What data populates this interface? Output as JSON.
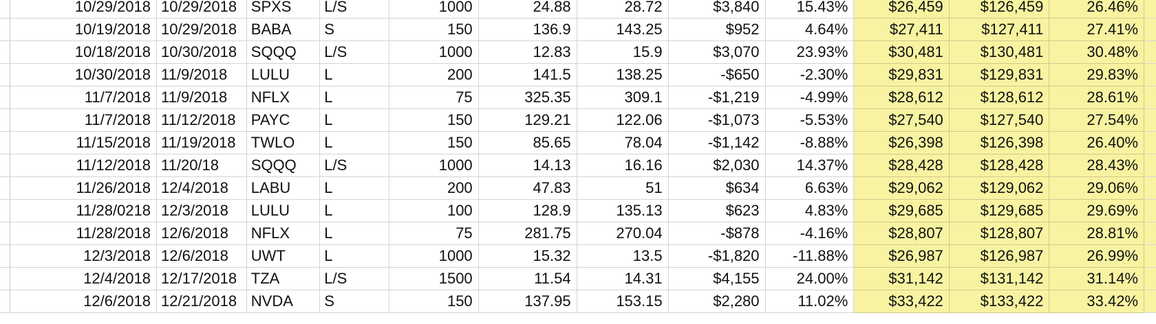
{
  "colors": {
    "positive": "#1f2de8",
    "negative": "#ff1d1d",
    "highlight": "#f8f3a1",
    "gridline": "#d4d4d4"
  },
  "rows": [
    {
      "entry": "10/29/2018",
      "exit": "10/29/2018",
      "ticker": "SPXS",
      "side": "L/S",
      "shares": "1000",
      "buy": "24.88",
      "sell": "28.72",
      "pl": "$3,840",
      "pct": "15.43%",
      "cum": "$26,459",
      "bal": "$126,459",
      "ret": "26.46%",
      "sign": "pos"
    },
    {
      "entry": "10/19/2018",
      "exit": "10/29/2018",
      "ticker": "BABA",
      "side": "S",
      "shares": "150",
      "buy": "136.9",
      "sell": "143.25",
      "pl": "$952",
      "pct": "4.64%",
      "cum": "$27,411",
      "bal": "$127,411",
      "ret": "27.41%",
      "sign": "pos"
    },
    {
      "entry": "10/18/2018",
      "exit": "10/30/2018",
      "ticker": "SQQQ",
      "side": "L/S",
      "shares": "1000",
      "buy": "12.83",
      "sell": "15.9",
      "pl": "$3,070",
      "pct": "23.93%",
      "cum": "$30,481",
      "bal": "$130,481",
      "ret": "30.48%",
      "sign": "pos"
    },
    {
      "entry": "10/30/2018",
      "exit": "11/9/2018",
      "ticker": "LULU",
      "side": "L",
      "shares": "200",
      "buy": "141.5",
      "sell": "138.25",
      "pl": "-$650",
      "pct": "-2.30%",
      "cum": "$29,831",
      "bal": "$129,831",
      "ret": "29.83%",
      "sign": "neg"
    },
    {
      "entry": "11/7/2018",
      "exit": "11/9/2018",
      "ticker": "NFLX",
      "side": "L",
      "shares": "75",
      "buy": "325.35",
      "sell": "309.1",
      "pl": "-$1,219",
      "pct": "-4.99%",
      "cum": "$28,612",
      "bal": "$128,612",
      "ret": "28.61%",
      "sign": "neg"
    },
    {
      "entry": "11/7/2018",
      "exit": "11/12/2018",
      "ticker": "PAYC",
      "side": "L",
      "shares": "150",
      "buy": "129.21",
      "sell": "122.06",
      "pl": "-$1,073",
      "pct": "-5.53%",
      "cum": "$27,540",
      "bal": "$127,540",
      "ret": "27.54%",
      "sign": "neg"
    },
    {
      "entry": "11/15/2018",
      "exit": "11/19/2018",
      "ticker": "TWLO",
      "side": "L",
      "shares": "150",
      "buy": "85.65",
      "sell": "78.04",
      "pl": "-$1,142",
      "pct": "-8.88%",
      "cum": "$26,398",
      "bal": "$126,398",
      "ret": "26.40%",
      "sign": "neg"
    },
    {
      "entry": "11/12/2018",
      "exit": "11/20/18",
      "ticker": "SQQQ",
      "side": "L/S",
      "shares": "1000",
      "buy": "14.13",
      "sell": "16.16",
      "pl": "$2,030",
      "pct": "14.37%",
      "cum": "$28,428",
      "bal": "$128,428",
      "ret": "28.43%",
      "sign": "pos"
    },
    {
      "entry": "11/26/2018",
      "exit": "12/4/2018",
      "ticker": "LABU",
      "side": "L",
      "shares": "200",
      "buy": "47.83",
      "sell": "51",
      "pl": "$634",
      "pct": "6.63%",
      "cum": "$29,062",
      "bal": "$129,062",
      "ret": "29.06%",
      "sign": "pos"
    },
    {
      "entry": "11/28/0218",
      "exit": "12/3/2018",
      "ticker": "LULU",
      "side": "L",
      "shares": "100",
      "buy": "128.9",
      "sell": "135.13",
      "pl": "$623",
      "pct": "4.83%",
      "cum": "$29,685",
      "bal": "$129,685",
      "ret": "29.69%",
      "sign": "pos"
    },
    {
      "entry": "11/28/2018",
      "exit": "12/6/2018",
      "ticker": "NFLX",
      "side": "L",
      "shares": "75",
      "buy": "281.75",
      "sell": "270.04",
      "pl": "-$878",
      "pct": "-4.16%",
      "cum": "$28,807",
      "bal": "$128,807",
      "ret": "28.81%",
      "sign": "neg"
    },
    {
      "entry": "12/3/2018",
      "exit": "12/6/2018",
      "ticker": "UWT",
      "side": "L",
      "shares": "1000",
      "buy": "15.32",
      "sell": "13.5",
      "pl": "-$1,820",
      "pct": "-11.88%",
      "cum": "$26,987",
      "bal": "$126,987",
      "ret": "26.99%",
      "sign": "neg"
    },
    {
      "entry": "12/4/2018",
      "exit": "12/17/2018",
      "ticker": "TZA",
      "side": "L/S",
      "shares": "1500",
      "buy": "11.54",
      "sell": "14.31",
      "pl": "$4,155",
      "pct": "24.00%",
      "cum": "$31,142",
      "bal": "$131,142",
      "ret": "31.14%",
      "sign": "pos"
    },
    {
      "entry": "12/6/2018",
      "exit": "12/21/2018",
      "ticker": "NVDA",
      "side": "S",
      "shares": "150",
      "buy": "137.95",
      "sell": "153.15",
      "pl": "$2,280",
      "pct": "11.02%",
      "cum": "$33,422",
      "bal": "$133,422",
      "ret": "33.42%",
      "sign": "pos"
    }
  ]
}
